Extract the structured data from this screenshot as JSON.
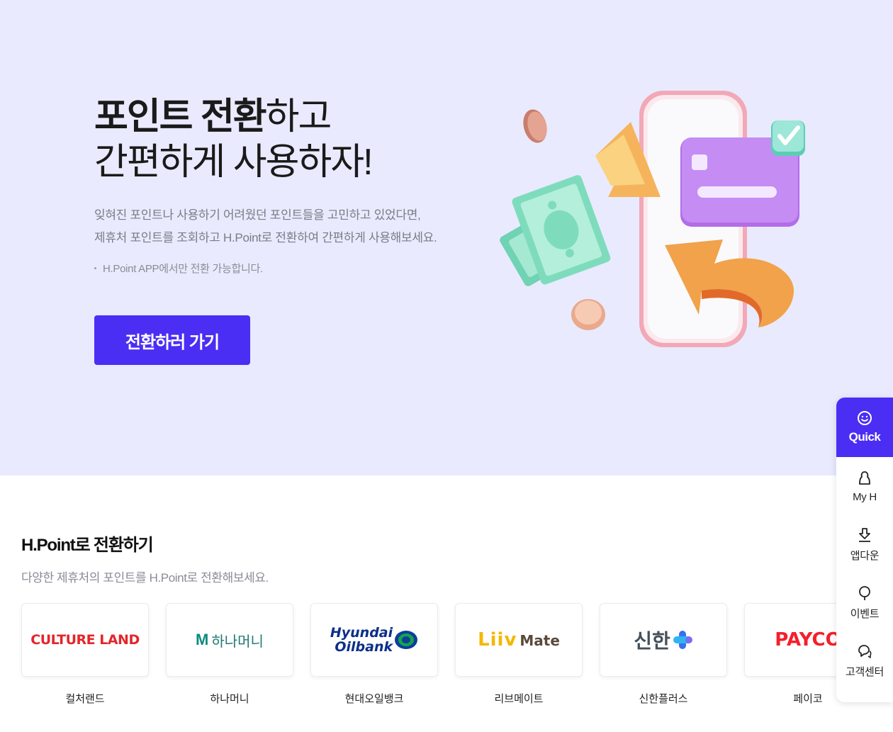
{
  "hero": {
    "title_bold": "포인트 전환",
    "title_rest": "하고",
    "title_line2": "간편하게 사용하자!",
    "desc_line1": "잊혀진 포인트나 사용하기 어려웠던 포인트들을 고민하고 있었다면,",
    "desc_line2": "제휴처 포인트를 조회하고 H.Point로 전환하여 간편하게 사용해보세요.",
    "note": "H.Point APP에서만 전환 가능합니다.",
    "cta_label": "전환하러 가기"
  },
  "section": {
    "title": "H.Point로 전환하기",
    "subtitle": "다양한 제휴처의 포인트를 H.Point로 전환해보세요."
  },
  "partners": [
    {
      "logo_text": "CULTURE LAND",
      "name": "컬처랜드"
    },
    {
      "logo_mark": "M",
      "logo_text": "하나머니",
      "name": "하나머니"
    },
    {
      "logo_text_1": "Hyundai",
      "logo_text_2": "Oilbank",
      "name": "현대오일뱅크"
    },
    {
      "logo_mark": "Liiv",
      "logo_text": "Mate",
      "name": "리브메이트"
    },
    {
      "logo_text": "신한",
      "name": "신한플러스"
    },
    {
      "logo_text": "PAYCO",
      "name": "페이코"
    }
  ],
  "quick_menu": {
    "head_label": "Quick",
    "items": [
      {
        "label": "My H",
        "icon": "user-icon"
      },
      {
        "label": "앱다운",
        "icon": "download-icon"
      },
      {
        "label": "이벤트",
        "icon": "event-icon"
      },
      {
        "label": "고객센터",
        "icon": "chat-icon"
      }
    ]
  },
  "colors": {
    "accent": "#4b2ef4",
    "hero_bg": "#e9eafd"
  }
}
